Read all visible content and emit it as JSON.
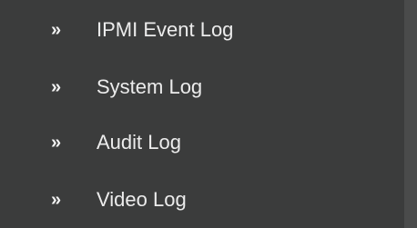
{
  "menu": {
    "icon": "double-chevron-right-icon",
    "items": [
      {
        "label": "IPMI Event Log"
      },
      {
        "label": "System Log"
      },
      {
        "label": "Audit Log"
      },
      {
        "label": "Video Log"
      }
    ]
  }
}
